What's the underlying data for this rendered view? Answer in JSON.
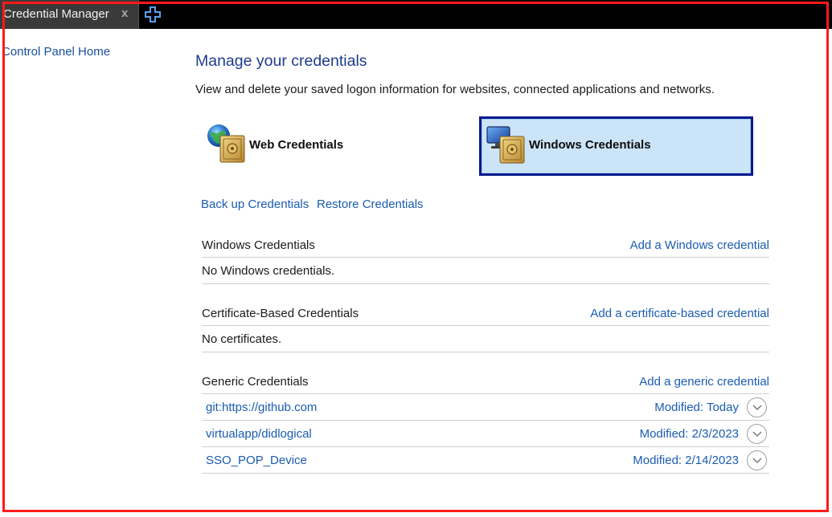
{
  "window": {
    "tab_title": "Credential Manager",
    "tab_close": "x"
  },
  "nav": {
    "home_link": "Control Panel Home"
  },
  "header": {
    "title": "Manage your credentials",
    "description": "View and delete your saved logon information for websites, connected applications and networks."
  },
  "tiles": {
    "web": "Web Credentials",
    "windows": "Windows Credentials",
    "selected": "windows"
  },
  "actions": {
    "backup": "Back up Credentials",
    "restore": "Restore Credentials"
  },
  "sections": {
    "windows": {
      "title": "Windows Credentials",
      "add_link": "Add a Windows credential",
      "empty_text": "No Windows credentials."
    },
    "certificate": {
      "title": "Certificate-Based Credentials",
      "add_link": "Add a certificate-based credential",
      "empty_text": "No certificates."
    },
    "generic": {
      "title": "Generic Credentials",
      "add_link": "Add a generic credential",
      "items": [
        {
          "name": "git:https://github.com",
          "modified": "Modified:  Today"
        },
        {
          "name": "virtualapp/didlogical",
          "modified": "Modified:  2/3/2023"
        },
        {
          "name": "SSO_POP_Device",
          "modified": "Modified:  2/14/2023"
        }
      ]
    }
  },
  "colors": {
    "link": "#1a5cb0",
    "title": "#1e3c8c",
    "selected_tile_bg": "#cce4f8",
    "selected_tile_border": "#0a1a8c",
    "frame_outline": "#ff1a1a"
  },
  "icons": {
    "new_tab": "plus-icon",
    "web_tile": "globe-vault-icon",
    "windows_tile": "monitor-vault-icon",
    "row_expand": "chevron-down-icon"
  }
}
